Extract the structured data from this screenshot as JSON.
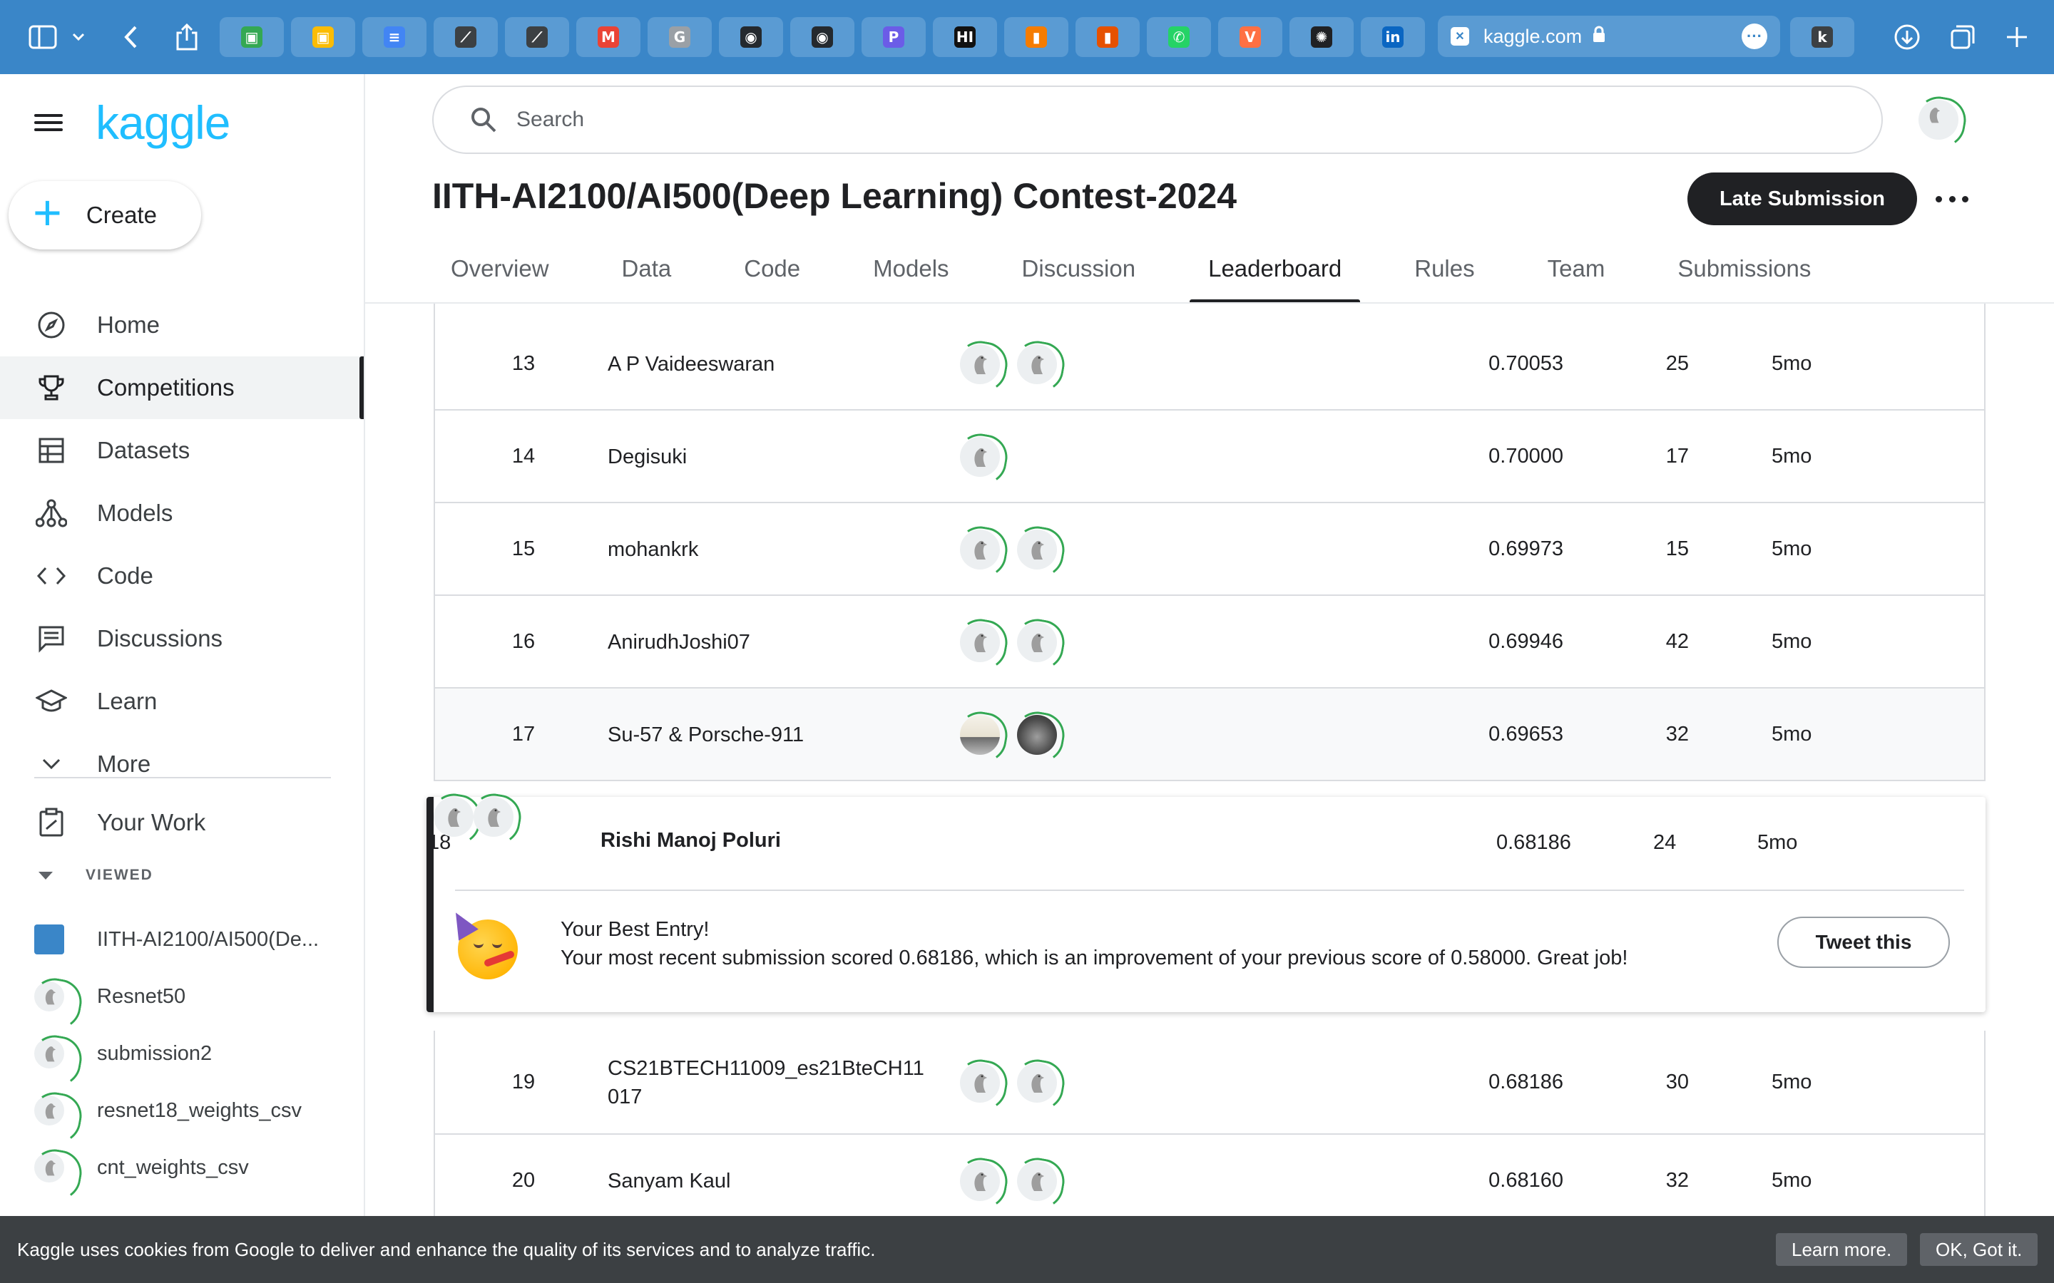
{
  "browser": {
    "address": "kaggle.com",
    "tab_glyphs": [
      "▣",
      "▣",
      "≡",
      "⟋",
      "⟋",
      "M",
      "G",
      "◉",
      "◉",
      "P",
      "HI",
      "▮",
      "▮",
      "✆",
      "V",
      "✺",
      "in"
    ],
    "tab_colors": [
      "#34a853",
      "#fbbc04",
      "#4285f4",
      "#3c4043",
      "#3c4043",
      "#ea4335",
      "#9aa0a6",
      "#24292e",
      "#24292e",
      "#6b5ce7",
      "#111111",
      "#f57c00",
      "#e65100",
      "#25d366",
      "#ff7043",
      "#202124",
      "#0a66c2"
    ],
    "extra_tab_glyph": "k"
  },
  "sidebar": {
    "logo": "kaggle",
    "create_label": "Create",
    "nav": [
      {
        "label": "Home",
        "icon": "compass-icon"
      },
      {
        "label": "Competitions",
        "icon": "trophy-icon"
      },
      {
        "label": "Datasets",
        "icon": "table-icon"
      },
      {
        "label": "Models",
        "icon": "models-icon"
      },
      {
        "label": "Code",
        "icon": "code-icon"
      },
      {
        "label": "Discussions",
        "icon": "comment-icon"
      },
      {
        "label": "Learn",
        "icon": "school-icon"
      },
      {
        "label": "More",
        "icon": "chevron-down-icon"
      }
    ],
    "your_work": "Your Work",
    "viewed_header": "VIEWED",
    "viewed": [
      "IITH-AI2100/AI500(De...",
      "Resnet50",
      "submission2",
      "resnet18_weights_csv",
      "cnt_weights_csv"
    ]
  },
  "header": {
    "search_placeholder": "Search",
    "title": "IITH-AI2100/AI500(Deep Learning) Contest-2024",
    "late_submission": "Late Submission",
    "tabs": [
      "Overview",
      "Data",
      "Code",
      "Models",
      "Discussion",
      "Leaderboard",
      "Rules",
      "Team",
      "Submissions"
    ],
    "active_tab": "Leaderboard"
  },
  "leaderboard": {
    "rows": [
      {
        "rank": "13",
        "team": "A P Vaideeswaran",
        "score": "0.70053",
        "entries": "25",
        "last": "5mo",
        "members": 2
      },
      {
        "rank": "14",
        "team": "Degisuki",
        "score": "0.70000",
        "entries": "17",
        "last": "5mo",
        "members": 1
      },
      {
        "rank": "15",
        "team": "mohankrk",
        "score": "0.69973",
        "entries": "15",
        "last": "5mo",
        "members": 2
      },
      {
        "rank": "16",
        "team": "AnirudhJoshi07",
        "score": "0.69946",
        "entries": "42",
        "last": "5mo",
        "members": 2
      },
      {
        "rank": "17",
        "team": "Su-57 & Porsche-911",
        "score": "0.69653",
        "entries": "32",
        "last": "5mo",
        "members": 2
      },
      {
        "rank": "18",
        "team": "Rishi Manoj Poluri",
        "score": "0.68186",
        "entries": "24",
        "last": "5mo",
        "members": 2
      },
      {
        "rank": "19",
        "team": "CS21BTECH11009_es21BteCH11 017",
        "score": "0.68186",
        "entries": "30",
        "last": "5mo",
        "members": 2
      },
      {
        "rank": "20",
        "team": "Sanyam Kaul",
        "score": "0.68160",
        "entries": "32",
        "last": "5mo",
        "members": 2
      }
    ],
    "best_entry": {
      "title": "Your Best Entry!",
      "message": "Your most recent submission scored 0.68186, which is an improvement of your previous score of 0.58000. Great job!",
      "tweet_label": "Tweet this"
    }
  },
  "cookie": {
    "text": "Kaggle uses cookies from Google to deliver and enhance the quality of its services and to analyze traffic.",
    "learn_more": "Learn more.",
    "ok": "OK, Got it."
  }
}
